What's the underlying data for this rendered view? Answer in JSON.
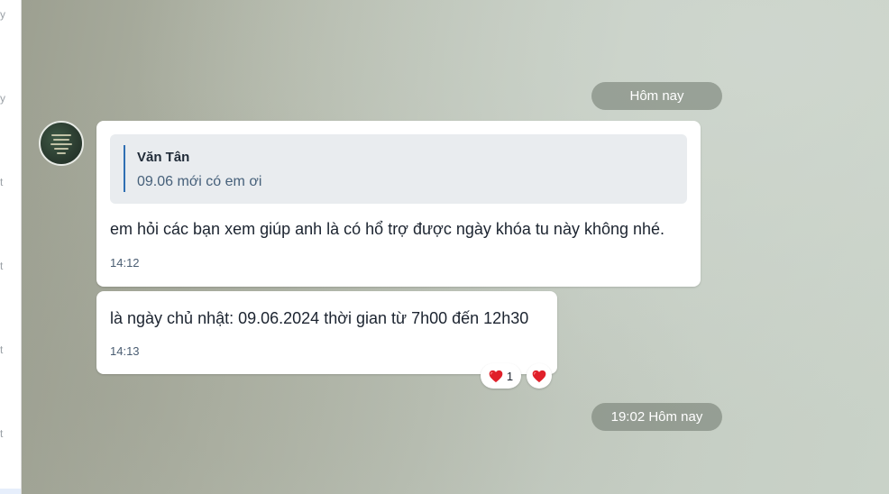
{
  "sidebar": {
    "marks": [
      "y",
      "y",
      "t",
      "t",
      "t",
      "t"
    ]
  },
  "chat": {
    "date_separator": "Hôm nay",
    "time_separator": "19:02 Hôm nay",
    "messages": [
      {
        "quote": {
          "author": "Văn Tân",
          "text": "09.06 mới có em ơi"
        },
        "text": "em hỏi các bạn xem giúp anh là có hổ trợ được ngày khóa tu này không nhé.",
        "time": "14:12"
      },
      {
        "text": "là ngày chủ nhật:  09.06.2024 thời gian từ 7h00 đến 12h30",
        "time": "14:13",
        "reactions": [
          {
            "icon": "heart-icon",
            "count": "1"
          },
          {
            "icon": "heart-icon"
          }
        ]
      }
    ]
  },
  "colors": {
    "accent": "#2f6fb3",
    "heart": "#e0202a"
  }
}
